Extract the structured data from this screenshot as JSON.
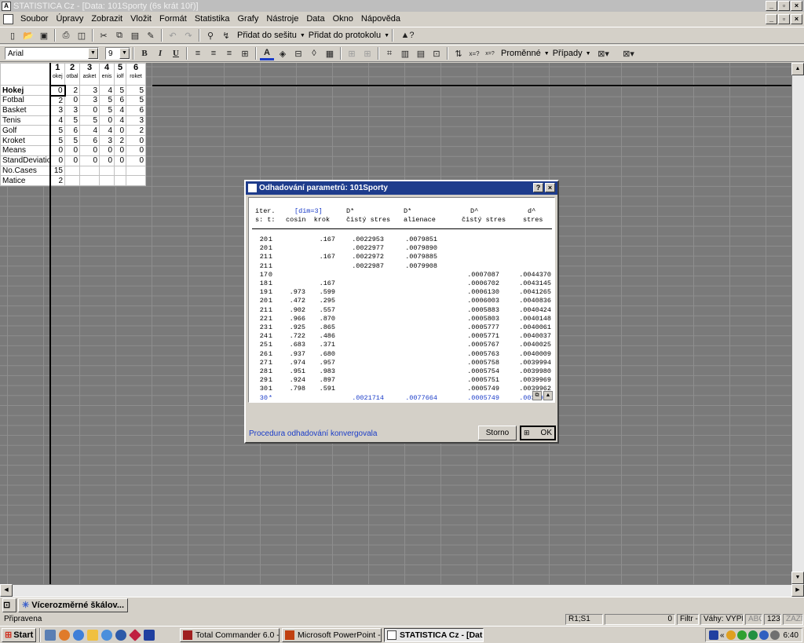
{
  "window": {
    "title": "STATISTICA Cz - [Data: 101Sporty (6s krát 10ř)]"
  },
  "menu": [
    "Soubor",
    "Úpravy",
    "Zobrazit",
    "Vložit",
    "Formát",
    "Statistika",
    "Grafy",
    "Nástroje",
    "Data",
    "Okno",
    "Nápověda"
  ],
  "toolbar1": {
    "add_workbook": "Přidat do sešitu",
    "add_report": "Přidat do protokolu"
  },
  "toolbar2": {
    "font": "Arial",
    "size": "9",
    "variables": "Proměnné",
    "cases": "Případy"
  },
  "sheet": {
    "columns": [
      {
        "num": "1",
        "name": "okej"
      },
      {
        "num": "2",
        "name": "otbal"
      },
      {
        "num": "3",
        "name": "asket"
      },
      {
        "num": "4",
        "name": "enis"
      },
      {
        "num": "5",
        "name": "iolf"
      },
      {
        "num": "6",
        "name": "roket"
      }
    ],
    "rows": [
      {
        "label": "Hokej",
        "values": [
          "0",
          "2",
          "3",
          "4",
          "5",
          "5"
        ]
      },
      {
        "label": "Fotbal",
        "values": [
          "2",
          "0",
          "3",
          "5",
          "6",
          "5"
        ]
      },
      {
        "label": "Basket",
        "values": [
          "3",
          "3",
          "0",
          "5",
          "4",
          "6"
        ]
      },
      {
        "label": "Tenis",
        "values": [
          "4",
          "5",
          "5",
          "0",
          "4",
          "3"
        ]
      },
      {
        "label": "Golf",
        "values": [
          "5",
          "6",
          "4",
          "4",
          "0",
          "2"
        ]
      },
      {
        "label": "Kroket",
        "values": [
          "5",
          "5",
          "6",
          "3",
          "2",
          "0"
        ]
      },
      {
        "label": "Means",
        "values": [
          "0",
          "0",
          "0",
          "0",
          "0",
          "0"
        ]
      },
      {
        "label": "StandDeviatio",
        "values": [
          "0",
          "0",
          "0",
          "0",
          "0",
          "0"
        ]
      },
      {
        "label": "No.Cases",
        "values": [
          "15",
          "",
          "",
          "",
          "",
          ""
        ]
      },
      {
        "label": "Matice",
        "values": [
          "2",
          "",
          "",
          "",
          "",
          ""
        ]
      }
    ]
  },
  "dialog": {
    "title": "Odhadování parametrů: 101Sporty",
    "headers": [
      {
        "l1": "iter.",
        "l2": "s: t:"
      },
      {
        "l1": "[dim=3]",
        "l2": "cosin  krok"
      },
      {
        "l1": "D*",
        "l2": "čistý stres"
      },
      {
        "l1": "D*",
        "l2": "alienace"
      },
      {
        "l1": "D^",
        "l2": "čistý stres"
      },
      {
        "l1": "d^",
        "l2": "stres"
      }
    ],
    "rows": [
      {
        "s": "20",
        "t": "1",
        "cosin": "",
        "krok": ".167",
        "dstar": ".0022953",
        "alien": ".0079851",
        "dhat": "",
        "stres": ""
      },
      {
        "s": "20",
        "t": "1",
        "cosin": "",
        "krok": "",
        "dstar": ".0022977",
        "alien": ".0079890",
        "dhat": "",
        "stres": ""
      },
      {
        "s": "21",
        "t": "1",
        "cosin": "",
        "krok": ".167",
        "dstar": ".0022972",
        "alien": ".0079885",
        "dhat": "",
        "stres": ""
      },
      {
        "s": "21",
        "t": "1",
        "cosin": "",
        "krok": "",
        "dstar": ".0022987",
        "alien": ".0079908",
        "dhat": "",
        "stres": ""
      },
      {
        "s": "17",
        "t": "0",
        "cosin": "",
        "krok": "",
        "dstar": "",
        "alien": "",
        "dhat": ".0007087",
        "stres": ".0044370"
      },
      {
        "s": "18",
        "t": "1",
        "cosin": "",
        "krok": ".167",
        "dstar": "",
        "alien": "",
        "dhat": ".0006702",
        "stres": ".0043145"
      },
      {
        "s": "19",
        "t": "1",
        "cosin": ".973",
        "krok": ".599",
        "dstar": "",
        "alien": "",
        "dhat": ".0006130",
        "stres": ".0041265"
      },
      {
        "s": "20",
        "t": "1",
        "cosin": ".472",
        "krok": ".295",
        "dstar": "",
        "alien": "",
        "dhat": ".0006003",
        "stres": ".0040836"
      },
      {
        "s": "21",
        "t": "1",
        "cosin": ".902",
        "krok": ".557",
        "dstar": "",
        "alien": "",
        "dhat": ".0005883",
        "stres": ".0040424"
      },
      {
        "s": "22",
        "t": "1",
        "cosin": ".966",
        "krok": ".870",
        "dstar": "",
        "alien": "",
        "dhat": ".0005803",
        "stres": ".0040148"
      },
      {
        "s": "23",
        "t": "1",
        "cosin": ".925",
        "krok": ".865",
        "dstar": "",
        "alien": "",
        "dhat": ".0005777",
        "stres": ".0040061"
      },
      {
        "s": "24",
        "t": "1",
        "cosin": ".722",
        "krok": ".486",
        "dstar": "",
        "alien": "",
        "dhat": ".0005771",
        "stres": ".0040037"
      },
      {
        "s": "25",
        "t": "1",
        "cosin": ".683",
        "krok": ".371",
        "dstar": "",
        "alien": "",
        "dhat": ".0005767",
        "stres": ".0040025"
      },
      {
        "s": "26",
        "t": "1",
        "cosin": ".937",
        "krok": ".680",
        "dstar": "",
        "alien": "",
        "dhat": ".0005763",
        "stres": ".0040009"
      },
      {
        "s": "27",
        "t": "1",
        "cosin": ".974",
        "krok": ".957",
        "dstar": "",
        "alien": "",
        "dhat": ".0005758",
        "stres": ".0039994"
      },
      {
        "s": "28",
        "t": "1",
        "cosin": ".951",
        "krok": ".983",
        "dstar": "",
        "alien": "",
        "dhat": ".0005754",
        "stres": ".0039980"
      },
      {
        "s": "29",
        "t": "1",
        "cosin": ".924",
        "krok": ".897",
        "dstar": "",
        "alien": "",
        "dhat": ".0005751",
        "stres": ".0039969"
      },
      {
        "s": "30",
        "t": "1",
        "cosin": ".798",
        "krok": ".591",
        "dstar": "",
        "alien": "",
        "dhat": ".0005749",
        "stres": ".0039962"
      },
      {
        "s": "30",
        "t": "*",
        "cosin": "",
        "krok": "",
        "dstar": ".0021714",
        "alien": ".0077664",
        "dhat": ".0005749",
        "stres": ".0039962"
      }
    ],
    "status": "Procedura odhadování konvergovala",
    "cancel": "Storno",
    "ok": "OK"
  },
  "taskrow": {
    "window": "Vícerozměrné škálov..."
  },
  "statusbar": {
    "ready": "Připravena",
    "cell": "Ř1;S1",
    "num": "0",
    "filter": "Filtr -",
    "weights": "Váhy: VYPN",
    "abc": "ABC",
    "n123": "123",
    "rec": "ZÁZN"
  },
  "taskbar": {
    "start": "Start",
    "tasks": [
      "Total Commander 6.0 - P...",
      "Microsoft PowerPoint - [...",
      "STATISTICA Cz - [Dat..."
    ],
    "clock": "6:40"
  },
  "colors": {
    "title_active": "#1e3c8c",
    "blue_text": "#1a3cc8"
  }
}
